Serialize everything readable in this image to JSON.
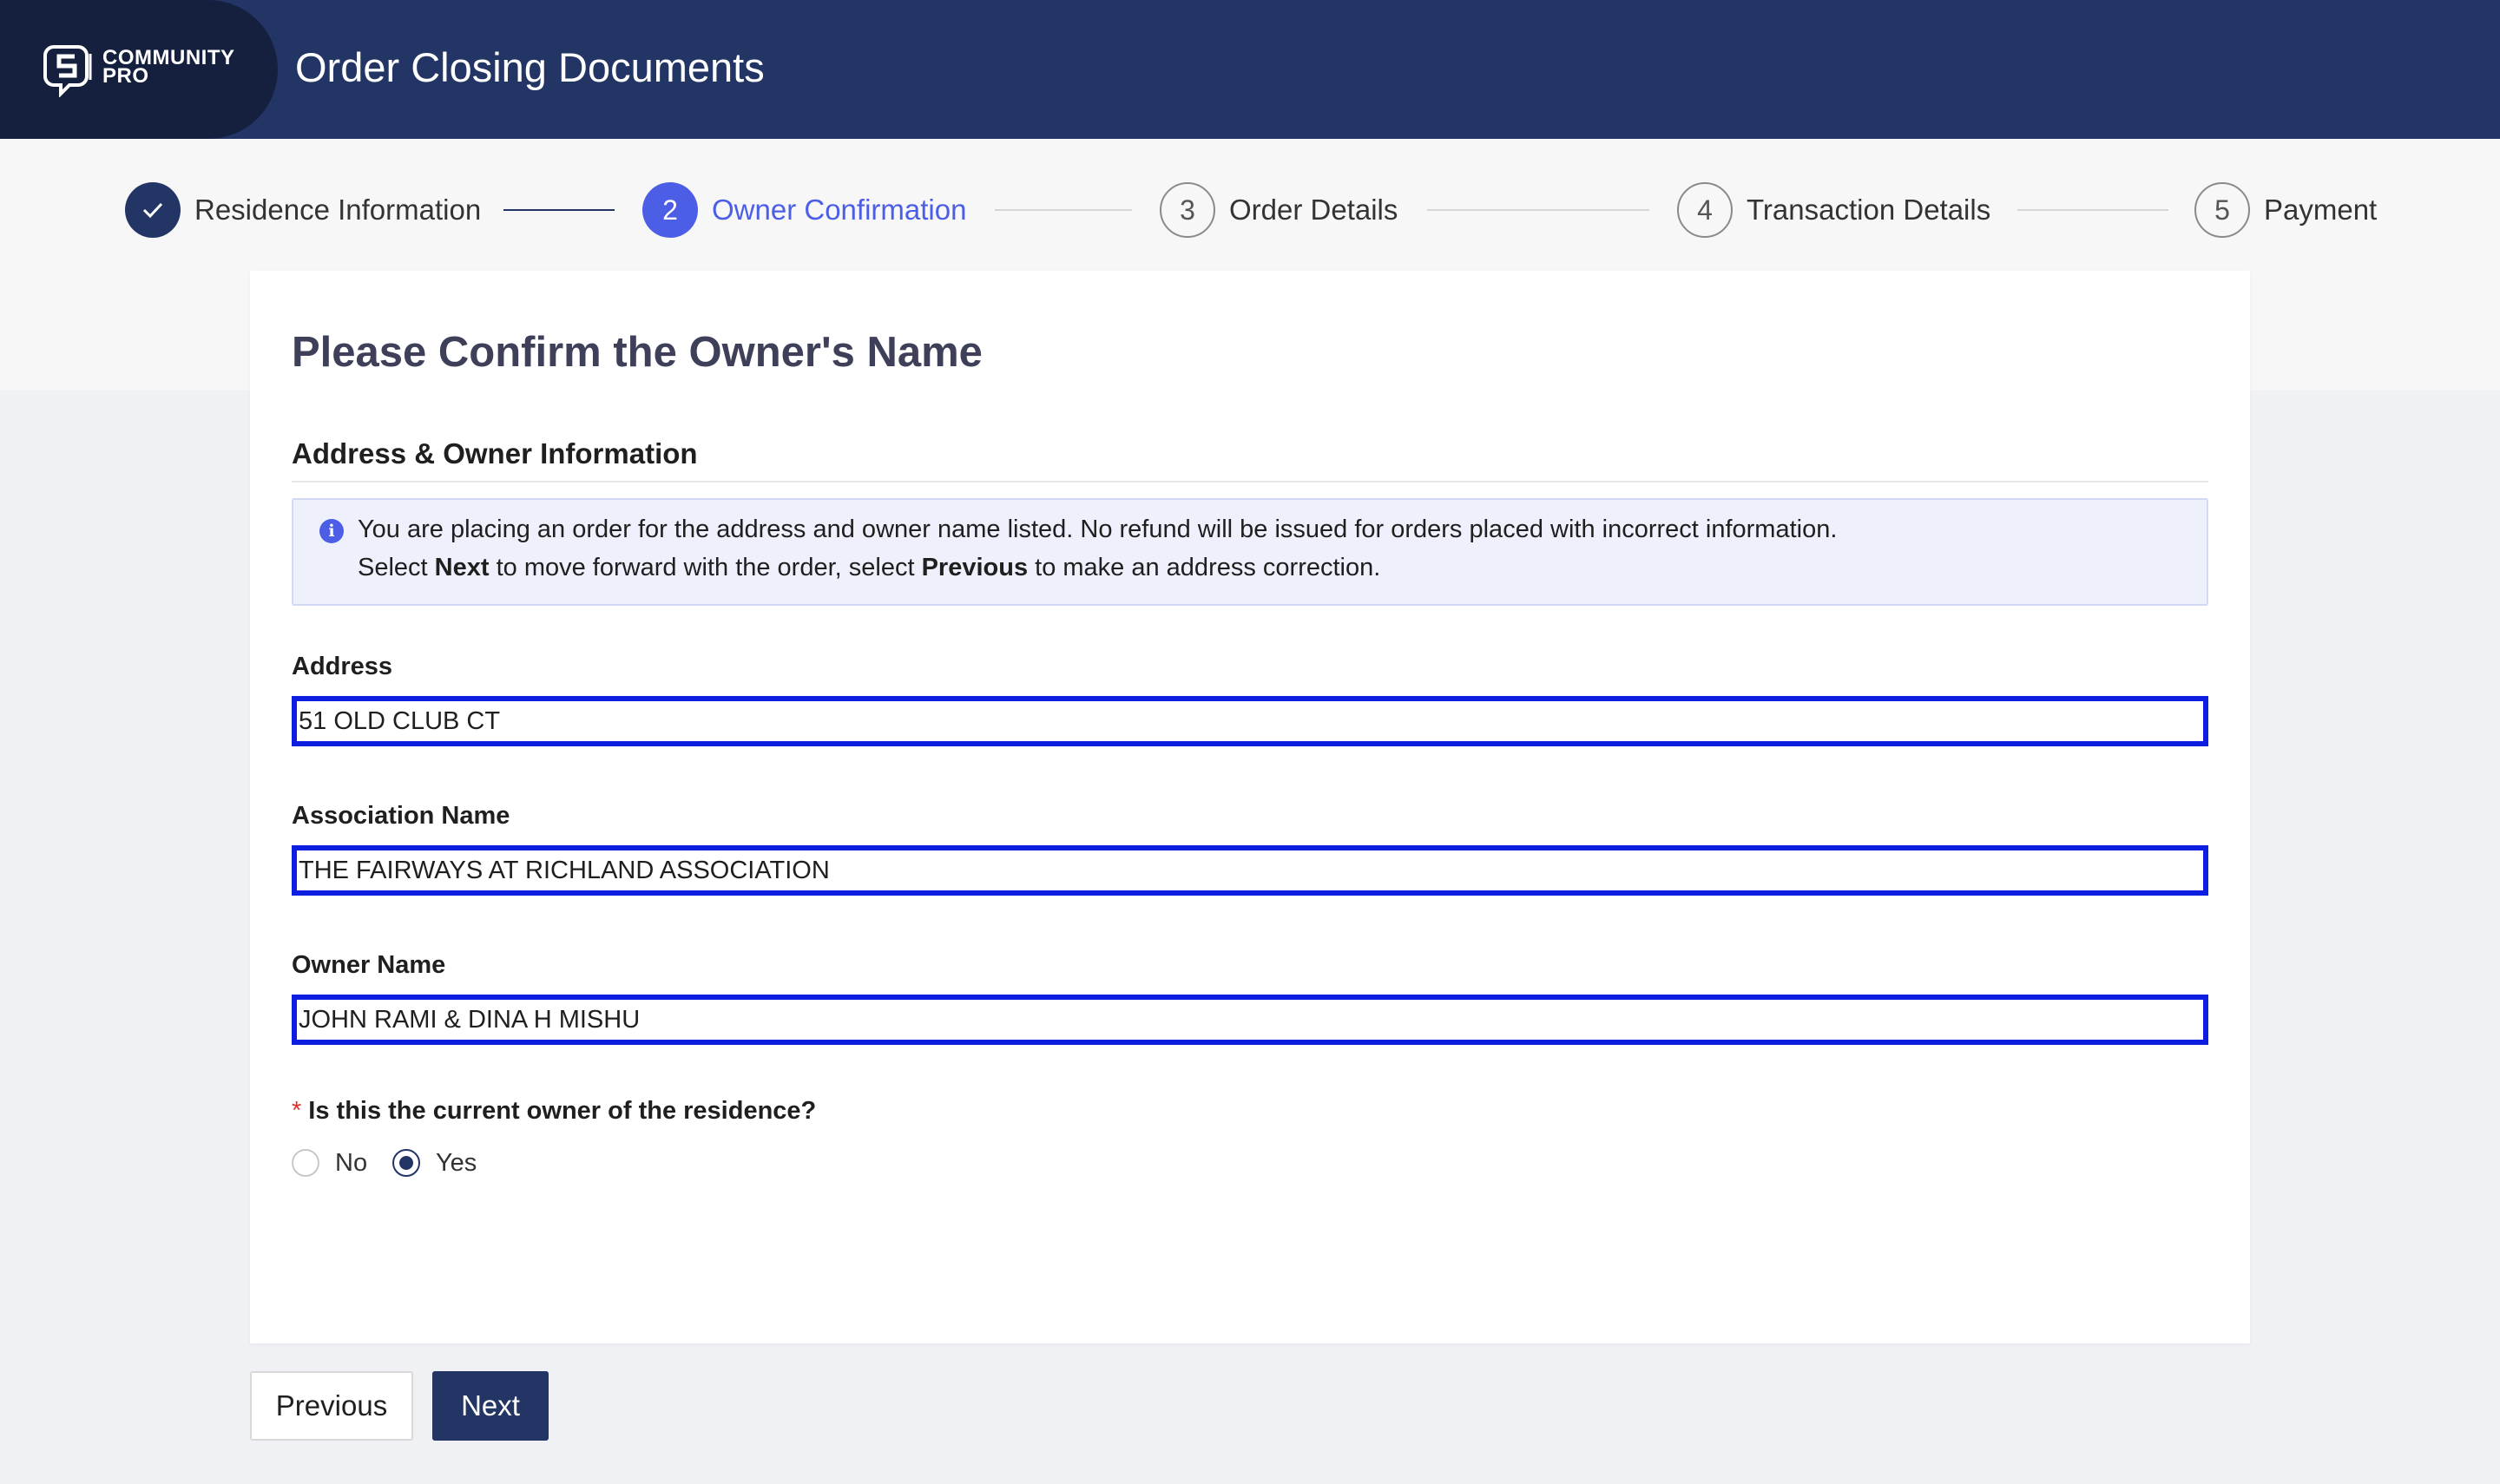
{
  "header": {
    "logo_line1": "COMMUNITY",
    "logo_line2": "PRO",
    "title": "Order Closing Documents",
    "background_color": "#233565"
  },
  "stepper": {
    "steps": [
      {
        "number": "1",
        "label": "Residence Information",
        "state": "completed",
        "icon": "check-icon"
      },
      {
        "number": "2",
        "label": "Owner Confirmation",
        "state": "active"
      },
      {
        "number": "3",
        "label": "Order Details",
        "state": "pending"
      },
      {
        "number": "4",
        "label": "Transaction Details",
        "state": "pending"
      },
      {
        "number": "5",
        "label": "Payment",
        "state": "pending"
      }
    ]
  },
  "card": {
    "title": "Please Confirm the Owner's Name",
    "section_title": "Address & Owner Information",
    "info": {
      "icon": "info-icon",
      "line1": "You are placing an order for the address and owner name listed. No refund will be issued for orders placed with incorrect information.",
      "line2_prefix": "Select ",
      "line2_next": "Next",
      "line2_middle": " to move forward with the order, select ",
      "line2_previous": "Previous",
      "line2_suffix": " to make an address correction."
    },
    "fields": {
      "address": {
        "label": "Address",
        "value": "51 OLD CLUB CT"
      },
      "association": {
        "label": "Association Name",
        "value": "THE FAIRWAYS AT RICHLAND ASSOCIATION"
      },
      "owner": {
        "label": "Owner Name",
        "value": "JOHN RAMI & DINA H MISHU"
      }
    },
    "question": {
      "required_mark": "*",
      "text": "Is this the current owner of the residence?",
      "options": [
        {
          "label": "No",
          "selected": false
        },
        {
          "label": "Yes",
          "selected": true
        }
      ]
    }
  },
  "buttons": {
    "previous": "Previous",
    "next": "Next"
  },
  "colors": {
    "primary": "#233565",
    "accent": "#4c5ee6",
    "field_highlight": "#0d1ee0"
  }
}
